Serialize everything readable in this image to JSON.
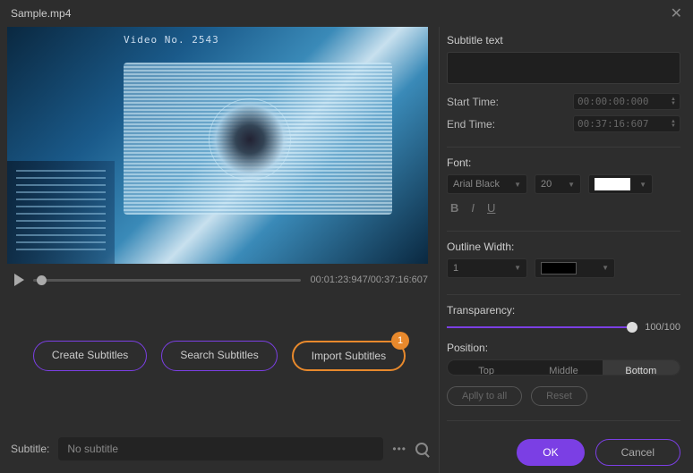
{
  "title": "Sample.mp4",
  "preview": {
    "overlay_text": "Video No. 2543"
  },
  "playback": {
    "current": "00:01:23:947",
    "total": "00:37:16:607"
  },
  "subtitle_buttons": {
    "create": "Create Subtitles",
    "search": "Search Subtitles",
    "import": "Import Subtitles",
    "import_badge": "1"
  },
  "subtitle_bar": {
    "label": "Subtitle:",
    "value": "No subtitle"
  },
  "panel": {
    "subtitle_text_label": "Subtitle text",
    "subtitle_text_value": "",
    "start_label": "Start Time:",
    "start_value": "00:00:00:000",
    "end_label": "End Time:",
    "end_value": "00:37:16:607",
    "font_label": "Font:",
    "font_family": "Arial Black",
    "font_size": "20",
    "bold": "B",
    "italic": "I",
    "underline": "U",
    "outline_label": "Outline Width:",
    "outline_value": "1",
    "transparency_label": "Transparency:",
    "transparency_value": "100/100",
    "position_label": "Position:",
    "position_top": "Top",
    "position_middle": "Middle",
    "position_bottom": "Bottom",
    "apply": "Aplly to all",
    "reset": "Reset"
  },
  "footer": {
    "ok": "OK",
    "cancel": "Cancel"
  }
}
